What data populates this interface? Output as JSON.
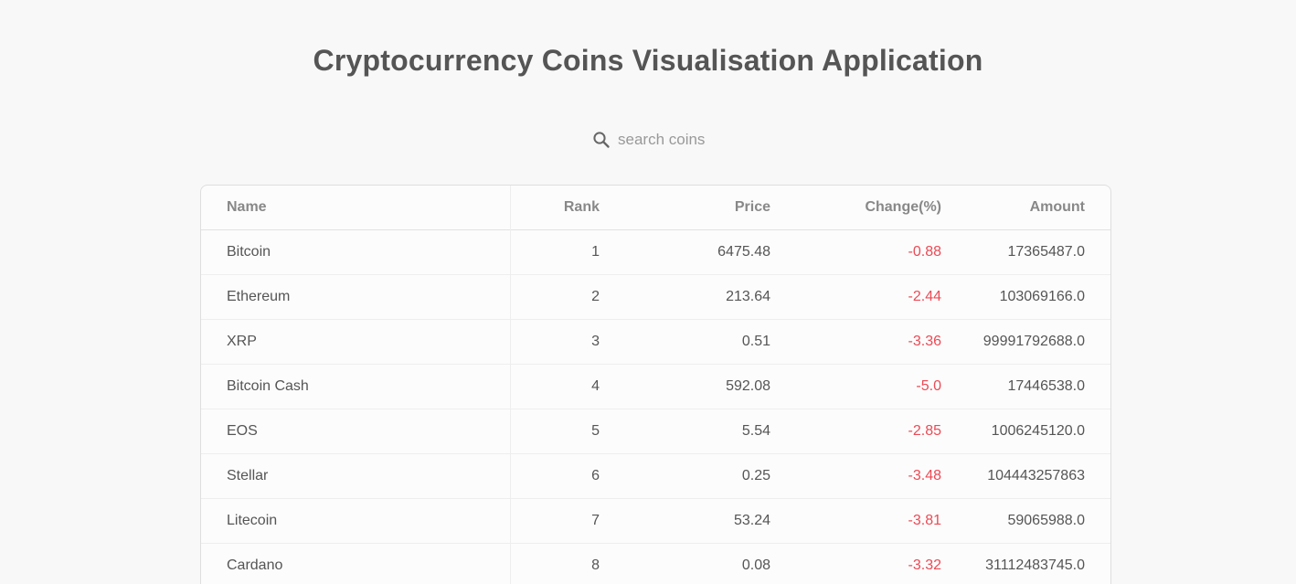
{
  "header": {
    "title": "Cryptocurrency Coins Visualisation Application"
  },
  "search": {
    "placeholder": "search coins",
    "value": "",
    "icon": "search-icon"
  },
  "table": {
    "columns": {
      "name": "Name",
      "rank": "Rank",
      "price": "Price",
      "change": "Change(%)",
      "amount": "Amount"
    },
    "rows": [
      {
        "name": "Bitcoin",
        "rank": "1",
        "price": "6475.48",
        "change": "-0.88",
        "amount": "17365487.0"
      },
      {
        "name": "Ethereum",
        "rank": "2",
        "price": "213.64",
        "change": "-2.44",
        "amount": "103069166.0"
      },
      {
        "name": "XRP",
        "rank": "3",
        "price": "0.51",
        "change": "-3.36",
        "amount": "99991792688.0"
      },
      {
        "name": "Bitcoin Cash",
        "rank": "4",
        "price": "592.08",
        "change": "-5.0",
        "amount": "17446538.0"
      },
      {
        "name": "EOS",
        "rank": "5",
        "price": "5.54",
        "change": "-2.85",
        "amount": "1006245120.0"
      },
      {
        "name": "Stellar",
        "rank": "6",
        "price": "0.25",
        "change": "-3.48",
        "amount": "104443257863"
      },
      {
        "name": "Litecoin",
        "rank": "7",
        "price": "53.24",
        "change": "-3.81",
        "amount": "59065988.0"
      },
      {
        "name": "Cardano",
        "rank": "8",
        "price": "0.08",
        "change": "-3.32",
        "amount": "31112483745.0"
      }
    ]
  },
  "colors": {
    "negative_change": "#ec4a55",
    "text": "#555555",
    "header_text": "#888888"
  }
}
